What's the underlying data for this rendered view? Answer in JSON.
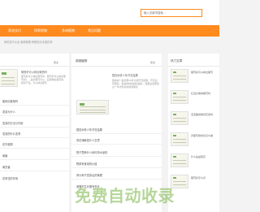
{
  "search": {
    "placeholder": "输入关键词搜索..."
  },
  "nav": {
    "items": [
      "养花技巧",
      "四季植物",
      "多肉植物",
      "常见问题"
    ]
  },
  "breadcrumb": "养花技巧大全 倒种植物·养植知识术语花草",
  "left": {
    "more": "更多",
    "article_title": "葡萄籽可以种出葡萄吗",
    "snippet": "葡萄籽可以种出葡萄吗，葡萄籽可以种出葡萄吗？，是的葡萄可以，后期种出葡萄的，和原产品，可以种出葡萄",
    "items": [
      "能种出葡萄吗",
      "发芽为什么",
      "发芽的方法与作用",
      "发芽的叶片发黄",
      "花卉植物",
      "病害",
      "病虫害",
      "花草花的作用"
    ]
  },
  "mid": {
    "title": "观赏植物",
    "more": "更多",
    "article_title": "银杏树多少年开花结果",
    "snippet": "银杏树一般需要20年才能开花结果，开花后有果实，银杏树树龄越长越好，结果后需要经过一年才能采收成熟果实",
    "items": [
      "银杏树多少年开花结果",
      "茶花涌麻是什么意思",
      "院子里种什么树好风水最旺",
      "野菜有食用的价值",
      "黄瓜种子发芽后的管理",
      "莴笋的生长期有多长"
    ]
  },
  "right": {
    "title": "热门文章",
    "items": [
      "葡萄籽可以种出葡萄",
      "红豆杉能种葡萄吗",
      "宝宝睡觉能闻花香吗",
      "养葡萄想成功怎么做",
      "什么是盆栽花",
      "葡萄籽怎么养"
    ]
  },
  "watermark": "免费自动收录"
}
